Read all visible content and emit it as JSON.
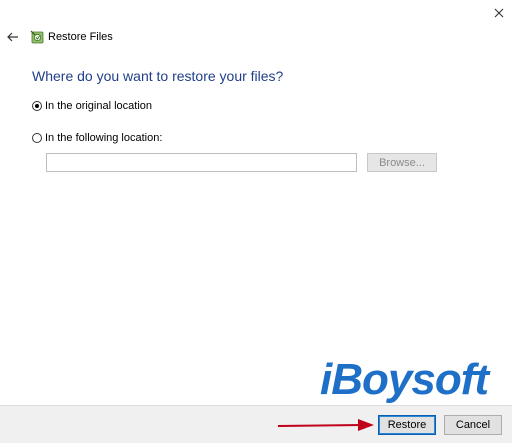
{
  "window": {
    "title": "Restore Files",
    "close_icon": "close-icon",
    "back_icon": "back-arrow-icon",
    "app_icon": "restore-files-icon"
  },
  "heading": "Where do you want to restore your files?",
  "options": {
    "original": {
      "label": "In the original location",
      "selected": true
    },
    "following": {
      "label": "In the following location:",
      "selected": false
    }
  },
  "location": {
    "value": "",
    "placeholder": ""
  },
  "browse_label": "Browse...",
  "footer": {
    "restore_label": "Restore",
    "cancel_label": "Cancel"
  },
  "watermark": "iBoysoft",
  "colors": {
    "heading": "#1f3f8a",
    "accent": "#0a5fb4",
    "arrow": "#c0001a",
    "watermark": "#1e6fc8"
  }
}
